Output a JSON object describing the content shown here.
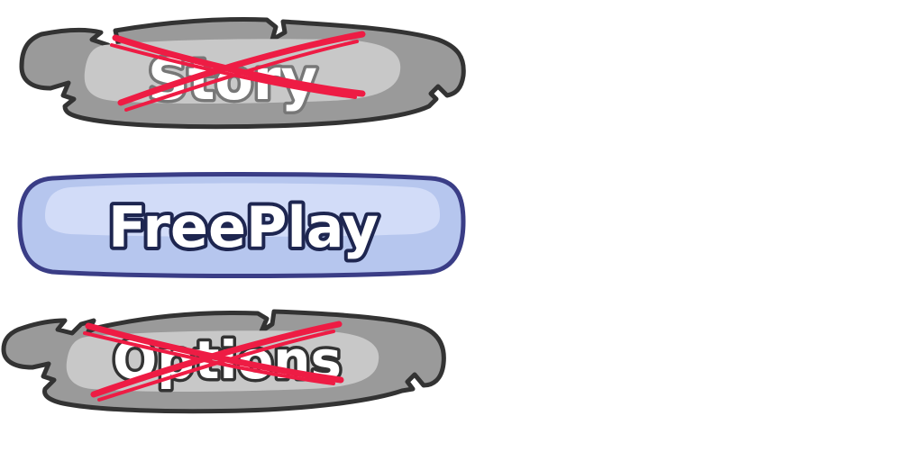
{
  "menu": {
    "items": [
      {
        "label": "Story",
        "state": "locked"
      },
      {
        "label": "FreePlay",
        "state": "selected"
      },
      {
        "label": "Options",
        "state": "locked"
      }
    ]
  },
  "colors": {
    "locked_frame": "#9a9a9a",
    "locked_inner": "#c8c8c8",
    "locked_text": "#ffffff",
    "locked_text_outline": "#777777",
    "outline": "#333333",
    "strike": "#ee1c44",
    "selected_frame": "#b6c6ee",
    "selected_inner": "#d2dcf8",
    "selected_outline": "#3a3d86",
    "selected_text": "#ffffff",
    "selected_text_outline": "#1e2650"
  },
  "icons": {
    "locked_mark": "cross-out-icon"
  }
}
